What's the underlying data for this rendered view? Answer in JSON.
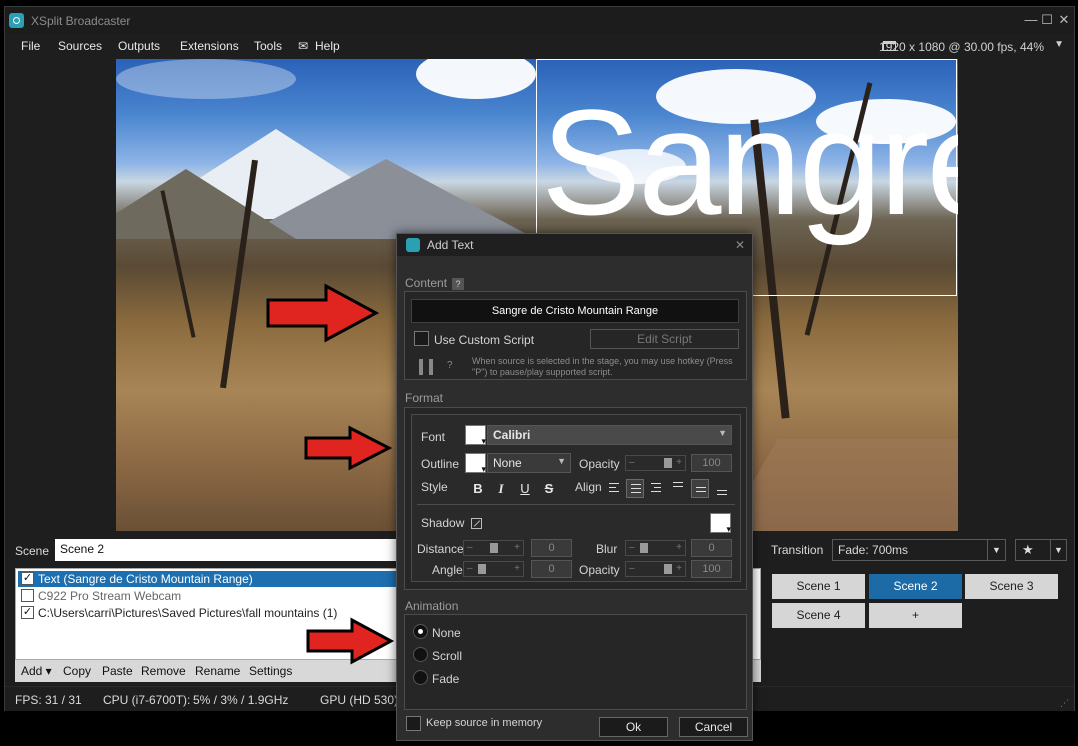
{
  "window": {
    "title": "XSplit Broadcaster",
    "controls": {
      "minimize": "—",
      "maximize": "☐",
      "close": "✕"
    }
  },
  "menu": {
    "items": [
      "File",
      "Sources",
      "Outputs",
      "Extensions",
      "Tools",
      "Help"
    ],
    "resolution": "1920 x 1080 @ 30.00 fps, 44%"
  },
  "stage": {
    "overlay_text": "Sangre"
  },
  "scene": {
    "label": "Scene",
    "name": "Scene 2",
    "sources": [
      {
        "label": "Text (Sangre de Cristo Mountain Range)",
        "checked": true,
        "selected": true
      },
      {
        "label": "C922 Pro Stream Webcam",
        "checked": false,
        "selected": false
      },
      {
        "label": "C:\\Users\\carri\\Pictures\\Saved Pictures\\fall mountains (1)",
        "checked": true,
        "selected": false
      }
    ],
    "toolbar": [
      "Add ▾",
      "Copy",
      "Paste",
      "Remove",
      "Rename",
      "Settings"
    ]
  },
  "transition": {
    "label": "Transition",
    "value": "Fade: 700ms"
  },
  "scenes": [
    "Scene 1",
    "Scene 2",
    "Scene 3",
    "Scene 4",
    "+"
  ],
  "active_scene": "Scene 2",
  "status": {
    "fps_label": "FPS:",
    "fps_value": "31 / 31",
    "cpu_label": "CPU (i7-6700T):",
    "cpu_value": "5% / 3% / 1.9GHz",
    "gpu_label": "GPU (HD 530):"
  },
  "dialog": {
    "title": "Add Text",
    "content_label": "Content",
    "content_value": "Sangre de Cristo Mountain Range",
    "use_custom_script": "Use Custom Script",
    "edit_script": "Edit Script",
    "hint": "When source is selected in the stage, you may use hotkey (Press \"P\") to pause/play supported script.",
    "format_label": "Format",
    "font_label": "Font",
    "font_value": "Calibri",
    "outline_label": "Outline",
    "outline_value": "None",
    "opacity_label": "Opacity",
    "opacity_value": "100",
    "style_label": "Style",
    "style_buttons": [
      "B",
      "I",
      "U",
      "S"
    ],
    "align_label": "Align",
    "shadow_label": "Shadow",
    "distance_label": "Distance",
    "distance_value": "0",
    "blur_label": "Blur",
    "blur_value": "0",
    "angle_label": "Angle",
    "angle_value": "0",
    "shadow_opacity_label": "Opacity",
    "shadow_opacity_value": "100",
    "animation_label": "Animation",
    "animation_options": [
      "None",
      "Scroll",
      "Fade"
    ],
    "animation_selected": "None",
    "keep_source": "Keep source in memory",
    "ok": "Ok",
    "cancel": "Cancel"
  },
  "colors": {
    "accent": "#1c6aa6",
    "arrow": "#e0241f",
    "dialog_bg": "#2d2d2d"
  }
}
